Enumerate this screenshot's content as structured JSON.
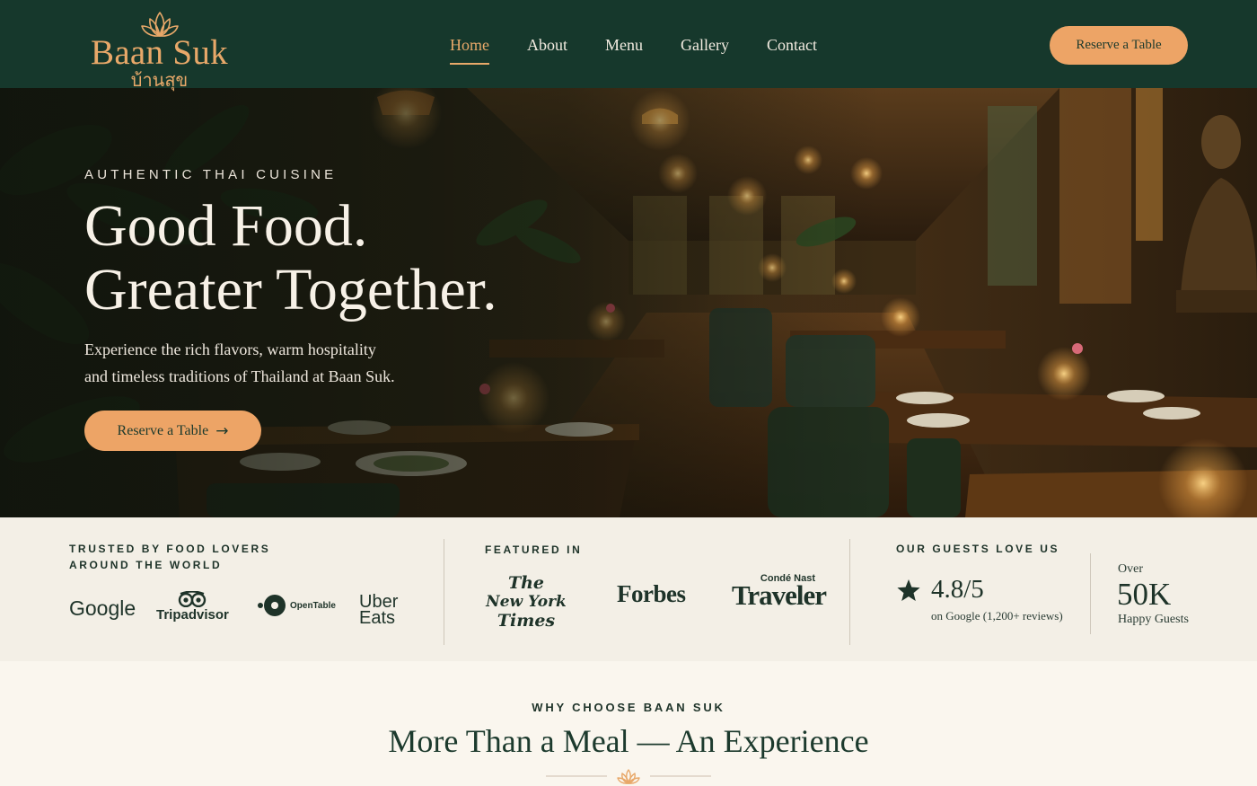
{
  "brand": {
    "name": "Baan Suk",
    "thai_name": "บ้านสุข",
    "accent_color": "#e8a869",
    "primary_color": "#16382c",
    "logo_icon": "lotus-icon"
  },
  "nav": {
    "items": [
      {
        "label": "Home",
        "active": true
      },
      {
        "label": "About",
        "active": false
      },
      {
        "label": "Menu",
        "active": false
      },
      {
        "label": "Gallery",
        "active": false
      },
      {
        "label": "Contact",
        "active": false
      }
    ],
    "cta_label": "Reserve a Table"
  },
  "hero": {
    "eyebrow": "AUTHENTIC THAI CUISINE",
    "title_line1": "Good Food.",
    "title_line2": "Greater Together.",
    "subtitle_line1": "Experience the rich flavors, warm hospitality",
    "subtitle_line2": "and timeless traditions of Thailand at Baan Suk.",
    "cta_label": "Reserve a Table",
    "cta_icon": "arrow-right-icon"
  },
  "trust": {
    "trusted": {
      "label_line1": "TRUSTED BY FOOD LOVERS",
      "label_line2": "AROUND THE WORLD",
      "logos": {
        "google": "Google",
        "tripadvisor": "Tripadvisor",
        "opentable": "OpenTable",
        "uber_line1": "Uber",
        "uber_line2": "Eats"
      }
    },
    "featured": {
      "label": "FEATURED IN",
      "nyt_line1": "The",
      "nyt_line2": "New York",
      "nyt_line3": "Times",
      "forbes": "Forbes",
      "cn_top": "Condé Nast",
      "cn_main": "Traveler"
    },
    "guests": {
      "label": "OUR GUESTS LOVE US",
      "rating": "4.8/5",
      "rating_icon": "star-icon",
      "rating_sub": "on Google (1,200+ reviews)",
      "over": "Over",
      "count": "50K",
      "count_label": "Happy Guests"
    }
  },
  "why": {
    "eyebrow": "WHY CHOOSE BAAN SUK",
    "title": "More Than a Meal — An Experience",
    "ornament_icon": "lotus-icon"
  }
}
